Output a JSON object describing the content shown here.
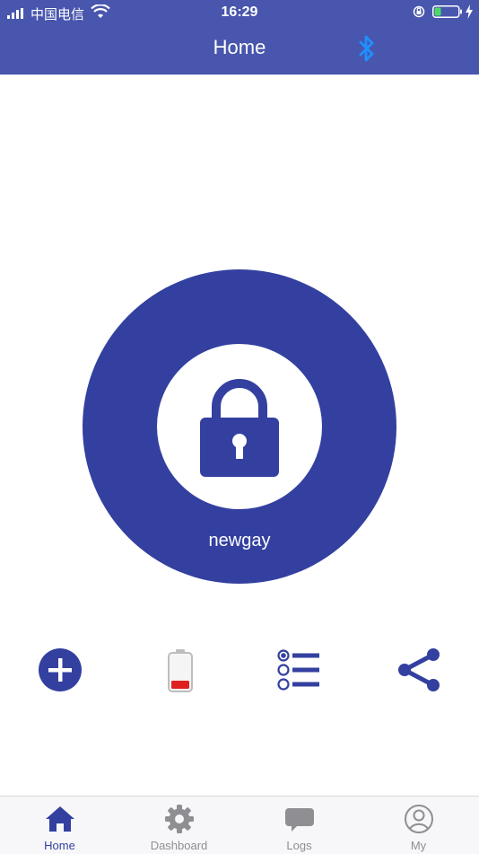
{
  "status_bar": {
    "carrier": "中国电信",
    "time": "16:29",
    "icons": [
      "signal-icon",
      "wifi-icon",
      "rotation-lock-icon",
      "battery-icon",
      "charging-icon"
    ]
  },
  "header": {
    "title": "Home",
    "right_icon": "bluetooth-icon"
  },
  "lock": {
    "device_name": "newgay",
    "icon": "lock-icon"
  },
  "actions": [
    {
      "name": "add",
      "icon": "plus-circle-icon"
    },
    {
      "name": "battery",
      "icon": "battery-low-icon"
    },
    {
      "name": "list",
      "icon": "list-icon"
    },
    {
      "name": "share",
      "icon": "share-icon"
    }
  ],
  "tabs": [
    {
      "label": "Home",
      "icon": "home-icon",
      "active": true
    },
    {
      "label": "Dashboard",
      "icon": "gear-icon",
      "active": false
    },
    {
      "label": "Logs",
      "icon": "chat-bubble-icon",
      "active": false
    },
    {
      "label": "My",
      "icon": "user-icon",
      "active": false
    }
  ],
  "colors": {
    "header_bg": "#4856ae",
    "primary": "#3340a0",
    "bluetooth": "#1e90ff",
    "tab_inactive": "#8e8e93",
    "battery_low": "#e02020"
  }
}
